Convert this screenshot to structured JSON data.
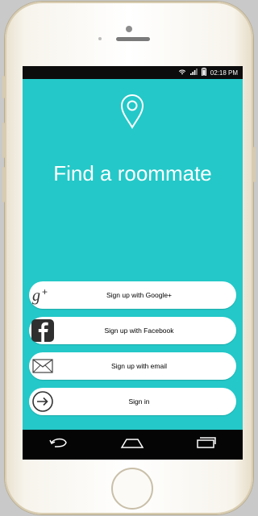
{
  "status_bar": {
    "time": "02:18 PM",
    "icons": [
      "wifi-icon",
      "signal-icon",
      "battery-icon"
    ]
  },
  "header": {
    "icon": "location-pin-icon",
    "title": "Find a roommate"
  },
  "buttons": [
    {
      "label": "Sign up with Google+",
      "icon": "google-plus-icon"
    },
    {
      "label": "Sign up with Facebook",
      "icon": "facebook-icon"
    },
    {
      "label": "Sign up with email",
      "icon": "email-icon"
    },
    {
      "label": "Sign in",
      "icon": "sign-in-icon"
    }
  ],
  "nav_bar": {
    "icons": [
      "back-icon",
      "home-icon",
      "recent-apps-icon"
    ]
  },
  "colors": {
    "accent": "#24c8c8",
    "button_bg": "#ffffff",
    "bar_bg": "#050505"
  }
}
